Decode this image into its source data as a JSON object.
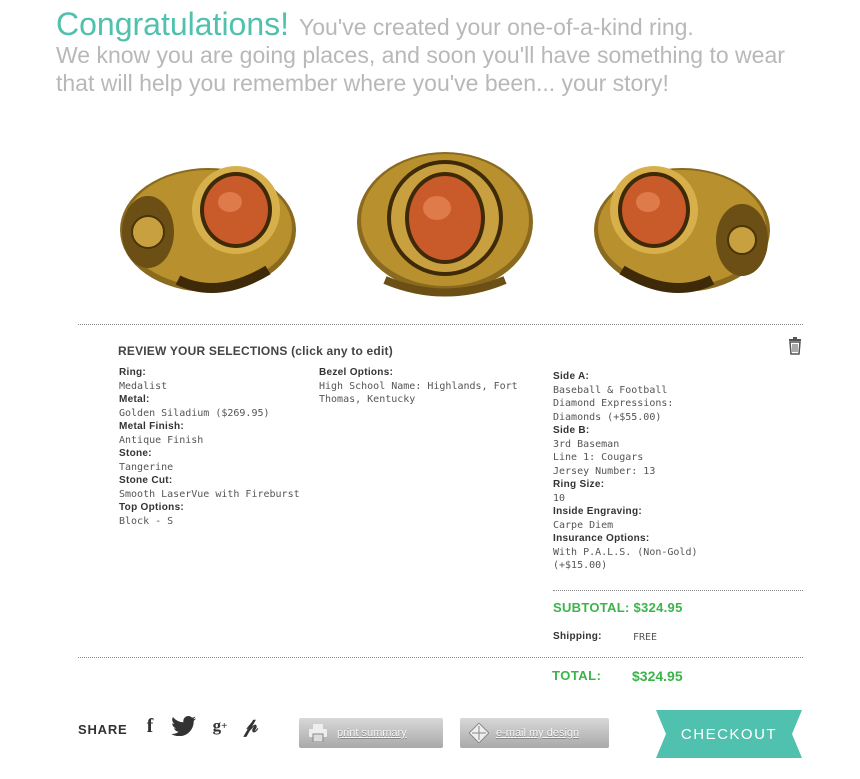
{
  "hero": {
    "congrats": "Congratulations!",
    "created": "You've created your one-of-a-kind ring.",
    "line2": "We know you are going places, and soon you'll have something to wear",
    "line3": "that will help you remember where you've been... your story!"
  },
  "rings": {
    "stone_color": "#c95a2a",
    "metal_color": "#b8902e",
    "views": [
      "left-side",
      "front",
      "right-side"
    ]
  },
  "review": {
    "title": "REVIEW YOUR SELECTIONS (click any to edit)",
    "col1": [
      {
        "label": "Ring:",
        "value": "Medalist"
      },
      {
        "label": "Metal:",
        "value": "Golden Siladium ($269.95)"
      },
      {
        "label": "Metal Finish:",
        "value": "Antique Finish"
      },
      {
        "label": "Stone:",
        "value": "Tangerine"
      },
      {
        "label": "Stone Cut:",
        "value": "Smooth LaserVue with Fireburst"
      },
      {
        "label": "Top Options:",
        "value": "Block - S"
      }
    ],
    "col2": [
      {
        "label": "Bezel Options:",
        "value": "High School Name: Highlands, Fort",
        "value2": "Thomas, Kentucky"
      }
    ],
    "col3": {
      "side_a_label": "Side A:",
      "side_a_1": "Baseball & Football",
      "side_a_2": "Diamond Expressions:",
      "side_a_3": "Diamonds (+$55.00)",
      "side_b_label": "Side B:",
      "side_b_1": "3rd Baseman",
      "side_b_2": "Line 1: Cougars",
      "side_b_3": "Jersey Number: 13",
      "ring_size_label": "Ring Size:",
      "ring_size": "10",
      "engraving_label": "Inside Engraving:",
      "engraving": "Carpe Diem",
      "insurance_label": "Insurance Options:",
      "insurance_1": "With P.A.L.S. (Non-Gold)",
      "insurance_2": "(+$15.00)"
    }
  },
  "totals": {
    "subtotal": "SUBTOTAL: $324.95",
    "shipping_label": "Shipping:",
    "shipping_value": "FREE",
    "total_label": "TOTAL:",
    "total_value": "$324.95"
  },
  "footer": {
    "share_label": "SHARE",
    "print_label": "print summary",
    "email_label": "e-mail my design",
    "checkout_label": "CHECKOUT",
    "accent": "#4fc1ae",
    "price_color": "#3bb44a"
  }
}
